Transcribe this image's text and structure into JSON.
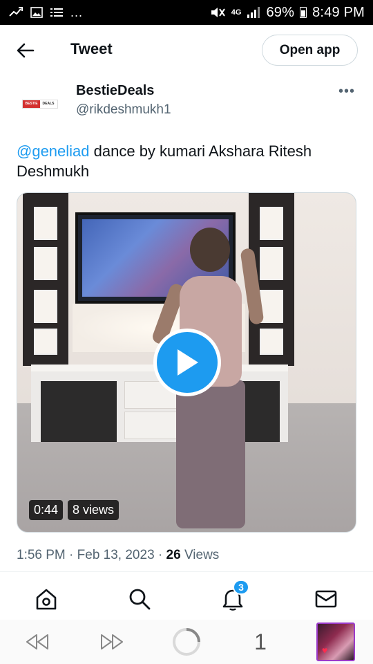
{
  "status_bar": {
    "network": "4G",
    "battery": "69%",
    "time": "8:49 PM",
    "overflow": "..."
  },
  "header": {
    "title": "Tweet",
    "open_app_label": "Open app"
  },
  "author": {
    "display_name": "BestieDeals",
    "handle": "@rikdeshmukh1",
    "logo_left": "BESTIE",
    "logo_right": "DEALS"
  },
  "tweet": {
    "mention": "@geneliad",
    "text": " dance by kumari Akshara Ritesh Deshmukh"
  },
  "video": {
    "duration": "0:44",
    "views": "8 views"
  },
  "meta": {
    "time": "1:56 PM",
    "date": "Feb 13, 2023",
    "views_count": "26",
    "views_label": "Views"
  },
  "bottom_nav": {
    "notifications_count": "3"
  },
  "browser": {
    "tab_count": "1"
  },
  "colors": {
    "accent": "#1d9bf0",
    "text": "#0f1419",
    "secondary": "#536471"
  }
}
